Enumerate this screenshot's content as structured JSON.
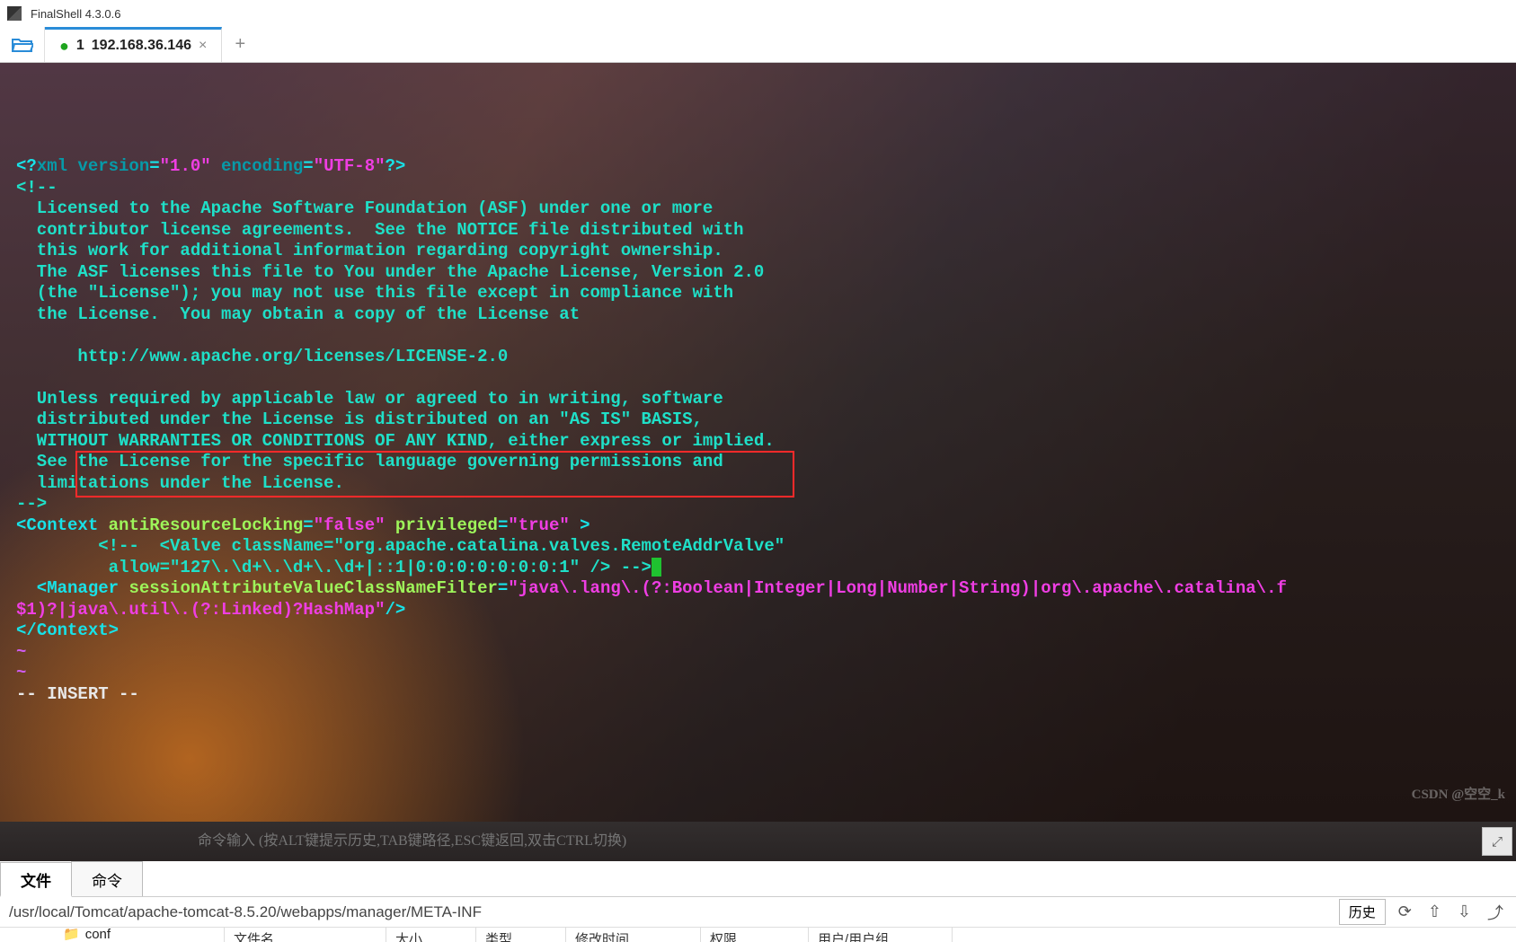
{
  "app": {
    "title": "FinalShell 4.3.0.6"
  },
  "tab": {
    "prefix": "1",
    "label": "192.168.36.146",
    "close": "×",
    "add": "+"
  },
  "term": {
    "l1a": "<?",
    "l1b": "xml version",
    "l1c": "=",
    "l1d": "\"1.0\"",
    "l1e": " encoding",
    "l1f": "=",
    "l1g": "\"UTF-8\"",
    "l1h": "?>",
    "l2": "<!--",
    "l3": "  Licensed to the Apache Software Foundation (ASF) under one or more",
    "l4": "  contributor license agreements.  See the NOTICE file distributed with",
    "l5": "  this work for additional information regarding copyright ownership.",
    "l6": "  The ASF licenses this file to You under the Apache License, Version 2.0",
    "l7": "  (the \"License\"); you may not use this file except in compliance with",
    "l8": "  the License.  You may obtain a copy of the License at",
    "l9": "",
    "l10": "      http://www.apache.org/licenses/LICENSE-2.0",
    "l11": "",
    "l12": "  Unless required by applicable law or agreed to in writing, software",
    "l13": "  distributed under the License is distributed on an \"AS IS\" BASIS,",
    "l14": "  WITHOUT WARRANTIES OR CONDITIONS OF ANY KIND, either express or implied.",
    "l15": "  See the License for the specific language governing permissions and",
    "l16": "  limitations under the License.",
    "l17": "-->",
    "l18a": "<",
    "l18b": "Context",
    "l18c": " antiResourceLocking",
    "l18d": "=",
    "l18e": "\"false\"",
    "l18f": " privileged",
    "l18g": "=",
    "l18h": "\"true\"",
    "l18i": " >",
    "l19": "        <!--  <Valve className=\"org.apache.catalina.valves.RemoteAddrValve\"",
    "l20": "         allow=\"127\\.\\d+\\.\\d+\\.\\d+|::1|0:0:0:0:0:0:0:1\" /> -->",
    "l21a": "  <",
    "l21b": "Manager",
    "l21c": " sessionAttributeValueClassNameFilter",
    "l21d": "=",
    "l21e": "\"java\\.lang\\.(?:Boolean|Integer|Long|Number|String)|org\\.apache\\.catalina\\.f",
    "l22a": "$1)?|java\\.util\\.(?:Linked)?HashMap\"",
    "l22b": "/>",
    "l23a": "</",
    "l23b": "Context",
    "l23c": ">",
    "mode": "-- INSERT --",
    "tilde": "~"
  },
  "cmd": {
    "placeholder": "命令输入 (按ALT键提示历史,TAB键路径,ESC键返回,双击CTRL切换)"
  },
  "bottom": {
    "tabs": {
      "file": "文件",
      "cmd": "命令"
    },
    "path": "/usr/local/Tomcat/apache-tomcat-8.5.20/webapps/manager/META-INF",
    "history": "历史",
    "treeItem": "conf",
    "cols": {
      "name": "文件名",
      "size": "大小",
      "type": "类型",
      "mtime": "修改时间",
      "perm": "权限",
      "owner": "用户/用户组"
    }
  },
  "watermark": "CSDN @空空_k"
}
